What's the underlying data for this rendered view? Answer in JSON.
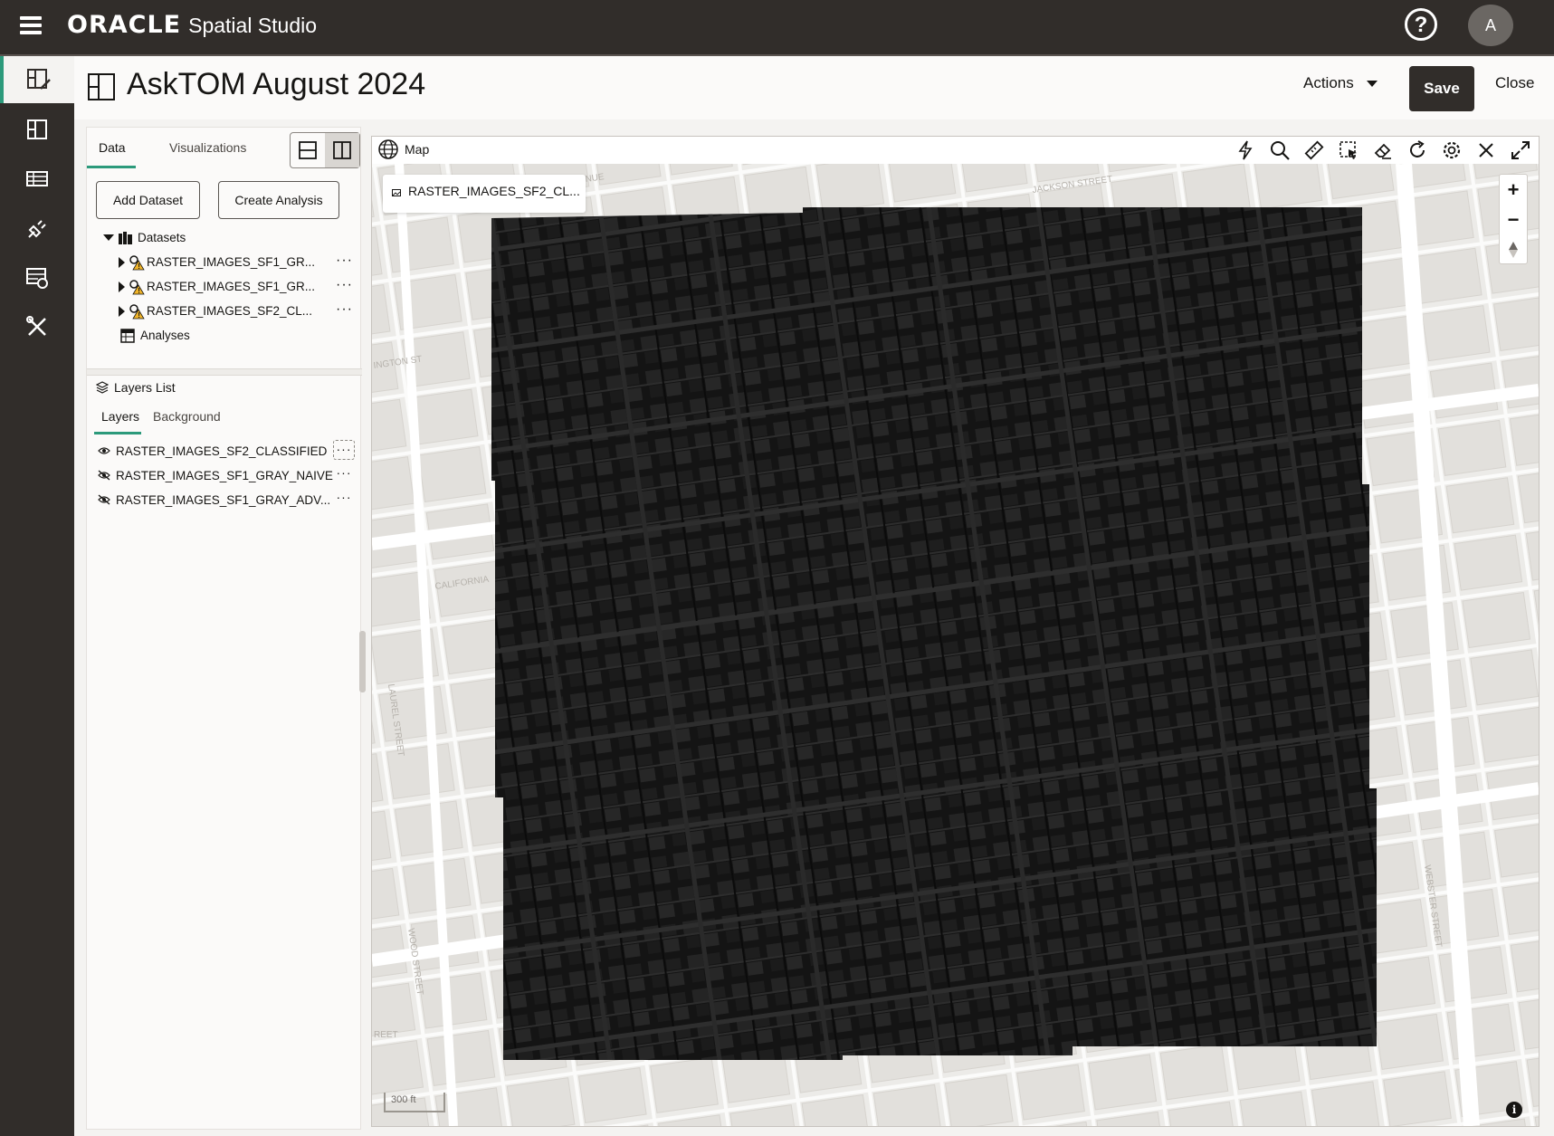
{
  "topbar": {
    "brand_oracle": "ORACLE",
    "brand_product": "Spatial Studio",
    "help_label": "?",
    "avatar_initial": "A"
  },
  "rail": {
    "items": [
      "project-editor-icon",
      "projects-icon",
      "datasets-icon",
      "connections-icon",
      "jobs-icon",
      "tools-icon"
    ],
    "active_index": 0,
    "accent_color": "#2c9a7b"
  },
  "header": {
    "title": "AskTOM August 2024",
    "actions_label": "Actions",
    "save_label": "Save",
    "close_label": "Close"
  },
  "left_panel": {
    "tabs": [
      "Data",
      "Visualizations"
    ],
    "active_tab": "Data",
    "add_dataset_label": "Add Dataset",
    "create_analysis_label": "Create Analysis",
    "datasets_label": "Datasets",
    "datasets": [
      {
        "name": "RASTER_IMAGES_SF1_GR...",
        "status": "warning"
      },
      {
        "name": "RASTER_IMAGES_SF1_GR...",
        "status": "warning"
      },
      {
        "name": "RASTER_IMAGES_SF2_CL...",
        "status": "warning"
      }
    ],
    "analyses_label": "Analyses",
    "more_label": "···"
  },
  "layers_panel": {
    "title": "Layers List",
    "tabs": [
      "Layers",
      "Background"
    ],
    "active_tab": "Layers",
    "layers": [
      {
        "name": "RASTER_IMAGES_SF2_CLASSIFIED",
        "visible": true
      },
      {
        "name": "RASTER_IMAGES_SF1_GRAY_NAIVE",
        "visible": false
      },
      {
        "name": "RASTER_IMAGES_SF1_GRAY_ADV...",
        "visible": false
      }
    ]
  },
  "map": {
    "title": "Map",
    "active_layer_chip": "RASTER_IMAGES_SF2_CL...",
    "toolbar": [
      "lightning-icon",
      "search-icon",
      "measure-icon",
      "select-icon",
      "eraser-icon",
      "refresh-icon",
      "settings-icon",
      "close-icon",
      "fullscreen-icon"
    ],
    "zoom_in": "+",
    "zoom_out": "−",
    "scale_label": "300 ft",
    "info_label": "i",
    "street_labels": [
      "JACKSON STREET",
      "CALIFORNIA",
      "LAUREL STREET",
      "WOOD STREET",
      "WEBSTER STREET",
      "INGTON ST",
      "NUE",
      "REET"
    ]
  }
}
